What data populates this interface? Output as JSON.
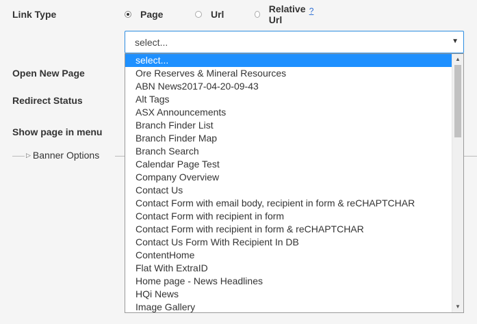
{
  "form": {
    "link_type_label": "Link Type",
    "open_new_page_label": "Open New Page",
    "redirect_status_label": "Redirect Status",
    "show_in_menu_label": "Show page in menu",
    "radios": [
      {
        "label": "Page",
        "checked": true
      },
      {
        "label": "Url",
        "checked": false
      },
      {
        "label": "Relative Url",
        "checked": false
      }
    ],
    "help_link": "?",
    "select_value": "select...",
    "select_arrow": "▼"
  },
  "banner": {
    "label": "Banner Options",
    "expand_icon": "triangle-right-icon"
  },
  "dropdown": {
    "selected_index": 0,
    "options": [
      "select...",
      "Ore Reserves & Mineral Resources",
      "ABN News2017-04-20-09-43",
      "Alt Tags",
      "ASX Announcements",
      "Branch Finder List",
      "Branch Finder Map",
      "Branch Search",
      "Calendar Page Test",
      "Company Overview",
      "Contact Us",
      "Contact Form with email body, recipient in form & reCHAPTCHAR",
      "Contact Form with recipient in form",
      "Contact Form with recipient in form & reCHAPTCHAR",
      "Contact Us Form With Recipient In DB",
      "ContentHome",
      "Flat With ExtraID",
      "Home page - News Headlines",
      "HQi News",
      "Image Gallery"
    ]
  },
  "colors": {
    "selected_option_bg": "#1e90ff",
    "focus_border": "#2a8be0",
    "page_bg": "#f5f5f5"
  }
}
